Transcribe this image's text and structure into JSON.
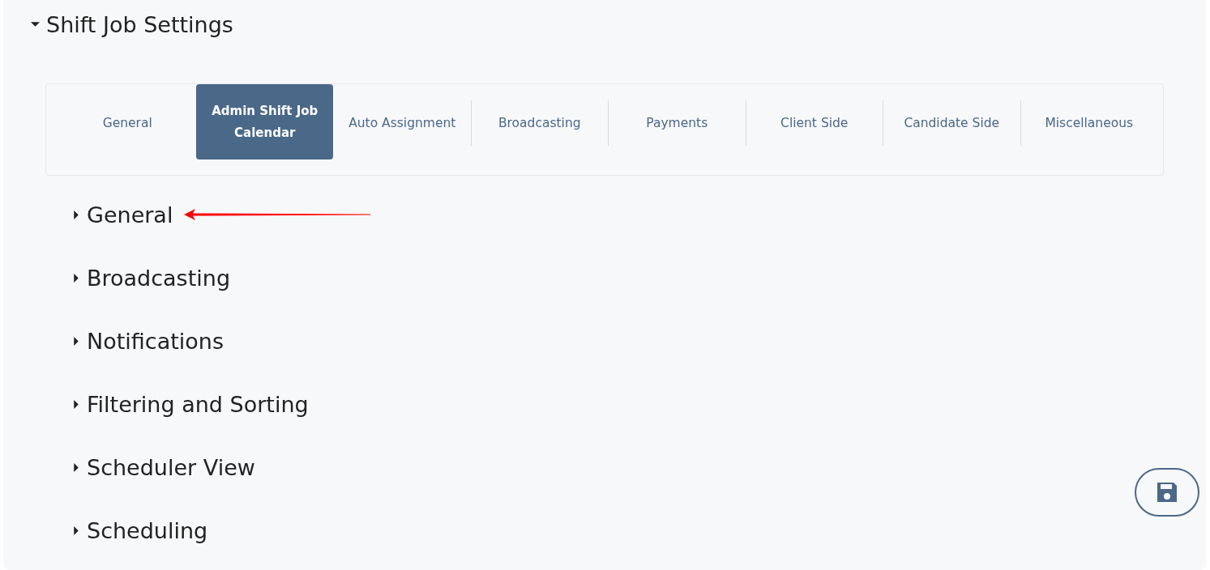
{
  "panel": {
    "title": "Shift Job Settings",
    "expanded": true
  },
  "tabs": [
    {
      "label": "General",
      "selected": false
    },
    {
      "label": "Admin Shift Job Calendar",
      "selected": true
    },
    {
      "label": "Auto Assignment",
      "selected": false
    },
    {
      "label": "Broadcasting",
      "selected": false
    },
    {
      "label": "Payments",
      "selected": false
    },
    {
      "label": "Client Side",
      "selected": false
    },
    {
      "label": "Candidate Side",
      "selected": false
    },
    {
      "label": "Miscellaneous",
      "selected": false
    }
  ],
  "sections": [
    {
      "title": "General",
      "expanded": false
    },
    {
      "title": "Broadcasting",
      "expanded": false
    },
    {
      "title": "Notifications",
      "expanded": false
    },
    {
      "title": "Filtering and Sorting",
      "expanded": false
    },
    {
      "title": "Scheduler View",
      "expanded": false
    },
    {
      "title": "Scheduling",
      "expanded": false
    }
  ]
}
